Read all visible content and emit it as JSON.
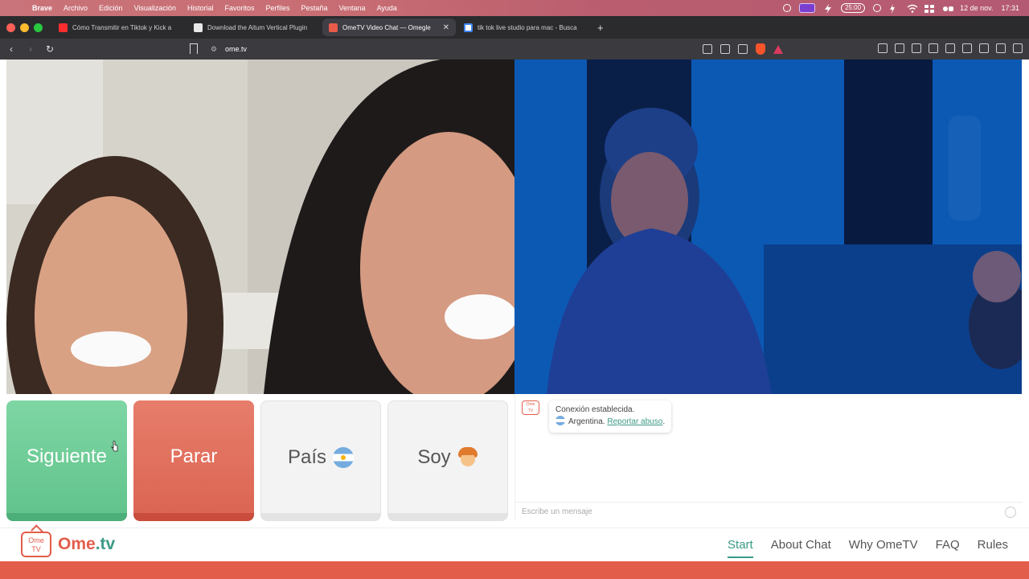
{
  "menubar": {
    "app": "Brave",
    "items": [
      "Archivo",
      "Edición",
      "Visualización",
      "Historial",
      "Favoritos",
      "Perfiles",
      "Pestaña",
      "Ventana",
      "Ayuda"
    ],
    "timer": "25:00",
    "date": "12 de nov.",
    "time": "17:31"
  },
  "tabs": [
    {
      "title": "Cómo Transmitir en Tiktok y Kick a",
      "favicon": "youtube-icon"
    },
    {
      "title": "Download the Aitum Vertical Plugin",
      "favicon": "download-icon"
    },
    {
      "title": "OmeTV Video Chat — Omegle",
      "favicon": "ometv-icon",
      "active": true
    },
    {
      "title": "tik tok live studio para mac - Busca",
      "favicon": "google-icon"
    }
  ],
  "address": {
    "url": "ome.tv"
  },
  "controls": {
    "next_label": "Siguiente",
    "stop_label": "Parar",
    "country_label": "País",
    "gender_label": "Soy"
  },
  "chat": {
    "status": "Conexión establecida.",
    "country": "Argentina.",
    "report": "Reportar abuso",
    "report_suffix": ".",
    "input_placeholder": "Escribe un mensaje"
  },
  "footer": {
    "brand_main": "Ome",
    "brand_tld": ".tv",
    "logo_top": "Ome",
    "logo_bottom": "TV",
    "nav": [
      "Start",
      "About Chat",
      "Why OmeTV",
      "FAQ",
      "Rules"
    ]
  },
  "colors": {
    "accent_green": "#3b9a86",
    "brand_red": "#e35d4b",
    "next_button": "#62c48c",
    "stop_button": "#dc6553"
  }
}
